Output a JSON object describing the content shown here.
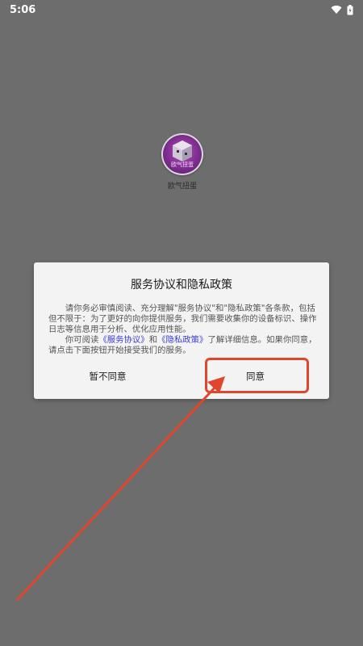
{
  "status_bar": {
    "time": "5:06"
  },
  "app": {
    "icon_text": "欧气扭蛋",
    "name": "欧气扭蛋"
  },
  "dialog": {
    "title": "服务协议和隐私政策",
    "para1": "请你务必审慎阅读、充分理解\"服务协议\"和\"隐私政策\"各条款，包括但不限于：为了更好的向你提供服务，我们需要收集你的设备标识、操作日志等信息用于分析、优化应用性能。",
    "para2_prefix": "你可阅读",
    "link_service": "《服务协议》",
    "para2_and": "和",
    "link_privacy": "《隐私政策》",
    "para2_suffix": "了解详细信息。如果你同意，请点击下面按钮开始接受我们的服务。",
    "decline_label": "暂不同意",
    "agree_label": "同意"
  },
  "colors": {
    "annotation": "#e0462d",
    "link": "#3a3adf"
  }
}
